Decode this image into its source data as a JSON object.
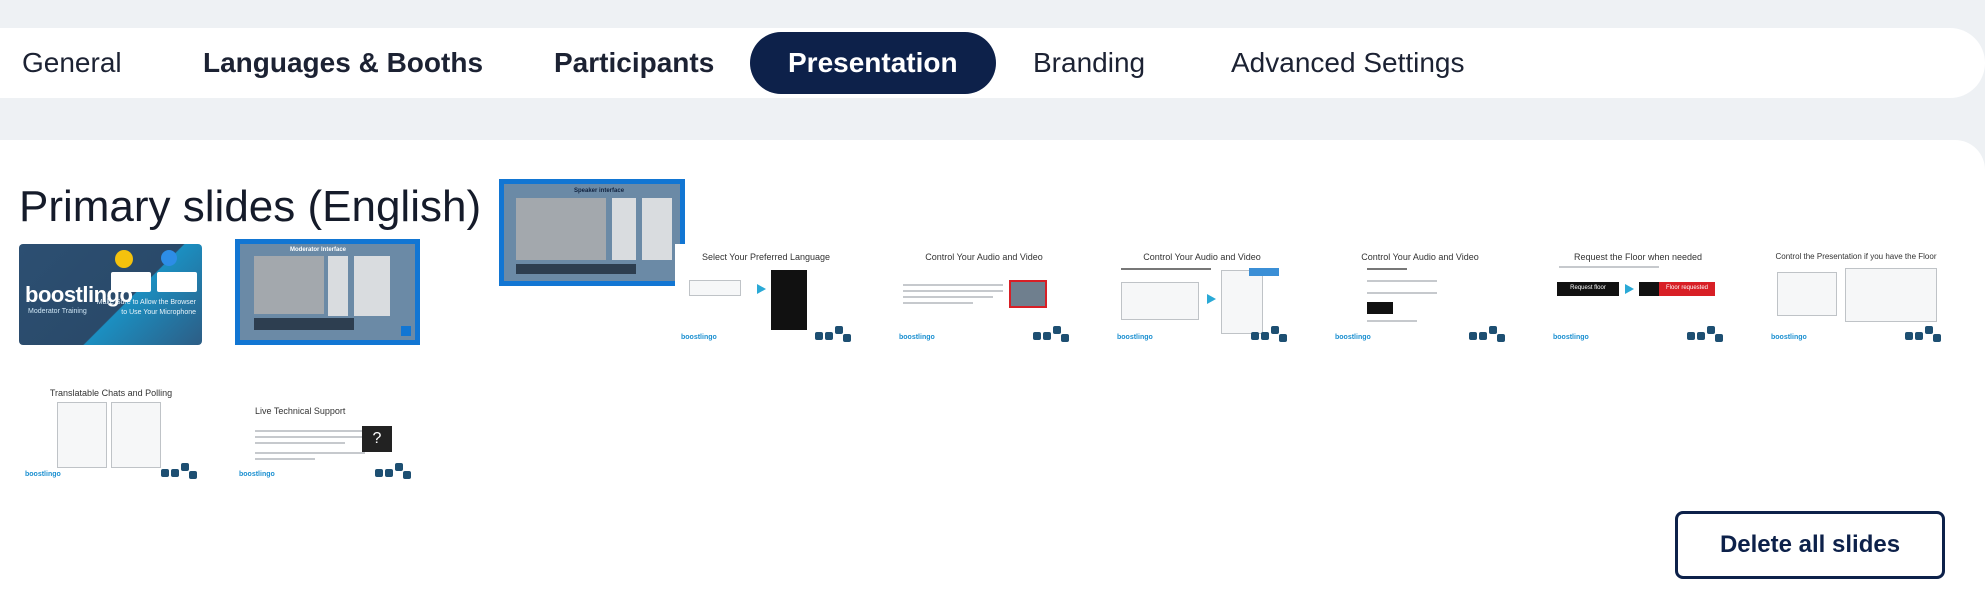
{
  "tabs": [
    {
      "label": "General"
    },
    {
      "label": "Languages & Booths"
    },
    {
      "label": "Participants"
    },
    {
      "label": "Presentation",
      "active": true
    },
    {
      "label": "Branding"
    },
    {
      "label": "Advanced Settings"
    }
  ],
  "section": {
    "title": "Primary slides (English)"
  },
  "slides": [
    {
      "logo": "boostlingo",
      "subtitle": "Moderator Training",
      "caption": "Make Sure to Allow the Browser to Use Your Microphone"
    },
    {
      "title": "Moderator Interface"
    },
    {
      "title": "Speaker interface"
    },
    {
      "title": "Select Your Preferred Language"
    },
    {
      "title": "Control Your Audio and Video"
    },
    {
      "title": "Control Your Audio and Video"
    },
    {
      "title": "Control Your Audio and Video"
    },
    {
      "title": "Request the Floor when needed",
      "button_request": "Request floor",
      "button_requested": "Floor requested"
    },
    {
      "title": "Control the Presentation if you have the Floor"
    },
    {
      "title": "Translatable Chats and Polling"
    },
    {
      "title": "Live Technical Support",
      "icon": "?"
    }
  ],
  "slide_logo": "boostlingo",
  "actions": {
    "delete_all": "Delete all slides"
  },
  "colors": {
    "navy": "#0d214a",
    "accent_blue": "#1276d3",
    "page_bg": "#eef1f4"
  }
}
